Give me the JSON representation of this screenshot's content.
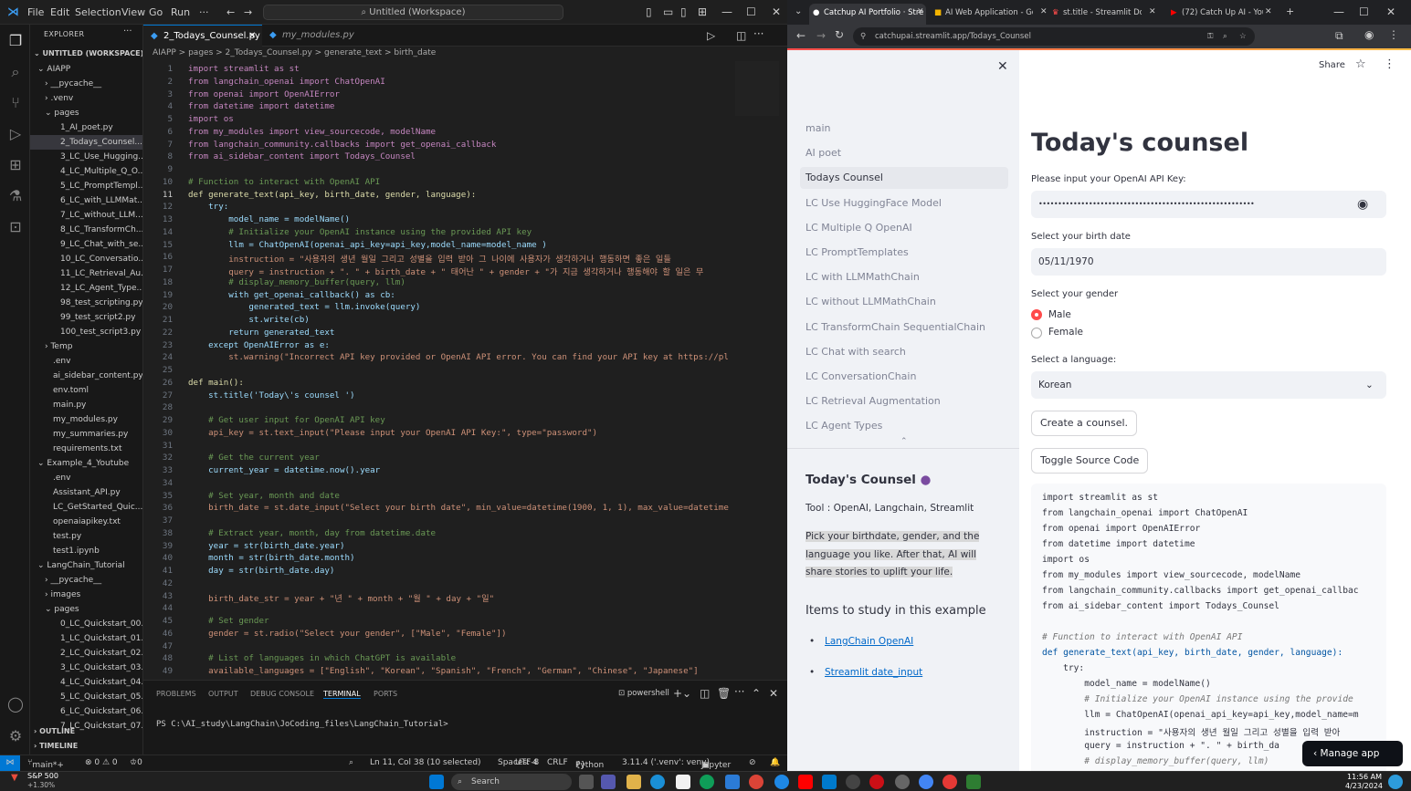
{
  "vscode": {
    "menu": [
      "File",
      "Edit",
      "Selection",
      "View",
      "Go",
      "Run",
      "···"
    ],
    "command_center": "Untitled (Workspace)",
    "explorer_title": "EXPLORER",
    "workspace": "UNTITLED (WORKSPACE)",
    "tree": [
      "AIAPP",
      "__pycache__",
      ".venv",
      "pages",
      "1_AI_poet.py",
      "2_Todays_Counsel....",
      "3_LC_Use_Hugging...",
      "4_LC_Multiple_Q_O...",
      "5_LC_PromptTempl...",
      "6_LC_with_LLMMat...",
      "7_LC_without_LLM...",
      "8_LC_TransformCh...",
      "9_LC_Chat_with_se...",
      "10_LC_Conversatio...",
      "11_LC_Retrieval_Au...",
      "12_LC_Agent_Type...",
      "98_test_scripting.py",
      "99_test_script2.py",
      "100_test_script3.py",
      "Temp",
      ".env",
      "ai_sidebar_content.py",
      "env.toml",
      "main.py",
      "my_modules.py",
      "my_summaries.py",
      "requirements.txt",
      "Example_4_Youtube",
      ".env",
      "Assistant_API.py",
      "LC_GetStarted_Quic...",
      "openaiapikey.txt",
      "test.py",
      "test1.ipynb",
      "LangChain_Tutorial",
      "__pycache__",
      "images",
      "pages",
      "0_LC_Quickstart_00...",
      "1_LC_Quickstart_01...",
      "2_LC_Quickstart_02...",
      "3_LC_Quickstart_03...",
      "4_LC_Quickstart_04...",
      "5_LC_Quickstart_05...",
      "6_LC_Quickstart_06...",
      "7_LC_Quickstart_07..."
    ],
    "outline": "OUTLINE",
    "timeline": "TIMELINE",
    "tab_active": "2_Todays_Counsel.py",
    "tab_other": "my_modules.py",
    "breadcrumb": "AIAPP > pages > 2_Todays_Counsel.py > generate_text > birth_date",
    "code": [
      "import streamlit as st",
      "from langchain_openai import ChatOpenAI",
      "from openai import OpenAIError",
      "from datetime import datetime",
      "import os",
      "from my_modules import view_sourcecode, modelName",
      "from langchain_community.callbacks import get_openai_callback",
      "from ai_sidebar_content import Todays_Counsel",
      "",
      "# Function to interact with OpenAI API",
      "def generate_text(api_key, birth_date, gender, language):",
      "    try:",
      "        model_name = modelName()",
      "        # Initialize your OpenAI instance using the provided API key",
      "        llm = ChatOpenAI(openai_api_key=api_key,model_name=model_name )",
      "        instruction = \"사용자의 생년 월일 그리고 성별을 입력 받아 그 나이에 사용자가 생각하거나 행동하면 좋은 일들",
      "        query = instruction + \". \" + birth_date + \" 태어난 \" + gender + \"가 지금 생각하거나 행동해야 할 일은 무",
      "        # display_memory_buffer(query, llm)",
      "        with get_openai_callback() as cb:",
      "            generated_text = llm.invoke(query)",
      "            st.write(cb)",
      "        return generated_text",
      "    except OpenAIError as e:",
      "        st.warning(\"Incorrect API key provided or OpenAI API error. You can find your API key at https://pl",
      "",
      "def main():",
      "    st.title('Today\\'s counsel ')",
      "",
      "    # Get user input for OpenAI API key",
      "    api_key = st.text_input(\"Please input your OpenAI API Key:\", type=\"password\")",
      "",
      "    # Get the current year",
      "    current_year = datetime.now().year",
      "",
      "    # Set year, month and date",
      "    birth_date = st.date_input(\"Select your birth date\", min_value=datetime(1900, 1, 1), max_value=datetime",
      "",
      "    # Extract year, month, day from datetime.date",
      "    year = str(birth_date.year)",
      "    month = str(birth_date.month)",
      "    day = str(birth_date.day)",
      "",
      "    birth_date_str = year + \"년 \" + month + \"월 \" + day + \"일\"",
      "",
      "    # Set gender",
      "    gender = st.radio(\"Select your gender\", [\"Male\", \"Female\"])",
      "",
      "    # List of languages in which ChatGPT is available",
      "    available_languages = [\"English\", \"Korean\", \"Spanish\", \"French\", \"German\", \"Chinese\", \"Japanese\"]"
    ],
    "panel_tabs": [
      "PROBLEMS",
      "OUTPUT",
      "DEBUG CONSOLE",
      "TERMINAL",
      "PORTS"
    ],
    "terminal_shell": "powershell",
    "terminal_prompt": "PS C:\\AI_study\\LangChain\\JoCoding_files\\LangChain_Tutorial>",
    "status": {
      "branch": "main*+",
      "errors": "⊗ 0 ⚠ 0",
      "ports": "♔0",
      "position": "Ln 11, Col 38 (10 selected)",
      "spaces": "Spaces: 4",
      "encoding": "UTF-8",
      "eol": "CRLF",
      "language": "Python",
      "interpreter": "3.11.4 ('.venv': venv)",
      "jupyter": "Jupyter"
    }
  },
  "browser": {
    "tabs": [
      "Catchup AI Portfolio · Stre",
      "AI Web Application - Goo",
      "st.title - Streamlit Docs",
      "(72) Catch Up AI - YouTub"
    ],
    "url": "catchupai.streamlit.app/Todays_Counsel",
    "share": "Share",
    "sidebar_nav": [
      "main",
      "AI poet",
      "Todays Counsel",
      "LC Use HuggingFace Model",
      "LC Multiple Q OpenAI",
      "LC PromptTemplates",
      "LC with LLMMathChain",
      "LC without LLMMathChain",
      "LC TransformChain SequentialChain",
      "LC Chat with search",
      "LC ConversationChain",
      "LC Retrieval Augmentation",
      "LC Agent Types"
    ],
    "sidebar_heading": "Today's Counsel",
    "sidebar_tools": "Tool : OpenAI, Langchain, Streamlit",
    "sidebar_desc": "Pick your birthdate, gender, and the language you like. After that, AI will share stories to uplift your life.",
    "items_heading": "Items to study in this example",
    "links": [
      "LangChain OpenAI",
      "Streamlit date_input"
    ],
    "title": "Today's counsel",
    "api_label": "Please input your OpenAI API Key:",
    "api_value": "••••••••••••••••••••••••••••••••••••••••••••••••••••••••",
    "date_label": "Select your birth date",
    "date_value": "05/11/1970",
    "gender_label": "Select your gender",
    "gender_options": [
      "Male",
      "Female"
    ],
    "language_label": "Select a language:",
    "language_value": "Korean",
    "create_button": "Create a counsel.",
    "toggle_button": "Toggle Source Code",
    "code_lines": [
      "import streamlit as st",
      "from langchain_openai import ChatOpenAI",
      "from openai import OpenAIError",
      "from datetime import datetime",
      "import os",
      "from my_modules import view_sourcecode, modelName",
      "from langchain_community.callbacks import get_openai_callbac",
      "from ai_sidebar_content import Todays_Counsel",
      "",
      "# Function to interact with OpenAI API",
      "def generate_text(api_key, birth_date, gender, language):",
      "    try:",
      "        model_name = modelName()",
      "        # Initialize your OpenAI instance using the provide",
      "        llm = ChatOpenAI(openai_api_key=api_key,model_name=m",
      "        instruction = \"사용자의 생년 월일 그리고 성별을 입력 받아",
      "        query = instruction + \". \" + birth_da",
      "        # display_memory_buffer(query, llm)"
    ],
    "manage_app": "Manage app"
  },
  "taskbar": {
    "stock_name": "S&P 500",
    "stock_change": "+1.30%",
    "search": "Search",
    "time": "11:56 AM",
    "date": "4/23/2024"
  },
  "colors": {
    "vscode_bg": "#1f1f1f",
    "streamlit_red": "#ff4b4b",
    "link_blue": "#0068c9"
  }
}
